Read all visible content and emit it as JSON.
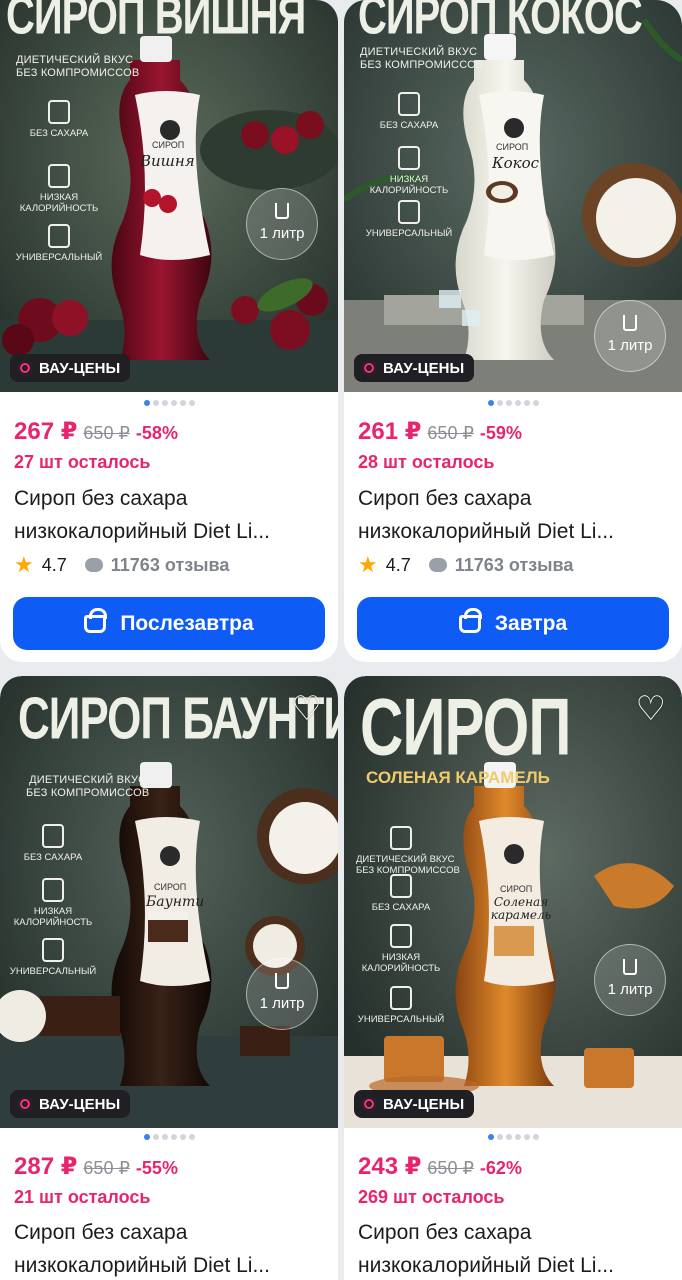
{
  "products": [
    {
      "banner_title": "СИРОП ВИШНЯ",
      "banner_sub": "ДИЕТИЧЕСКИЙ ВКУС\nБЕЗ КОМПРОМИССОВ",
      "features": [
        "БЕЗ САХАРА",
        "НИЗКАЯ\nКАЛОРИЙНОСТЬ",
        "УНИВЕРСАЛЬНЫЙ"
      ],
      "label_top": "СИРОП",
      "label_name": "Вишня",
      "volume": "1 литр",
      "badge": "ВАУ-ЦЕНЫ",
      "price": "267 ₽",
      "old_price": "650 ₽",
      "discount": "-58%",
      "stock": "27 шт осталось",
      "title_line1": "Сироп без сахара",
      "title_line2": "низкокалорийный Diet Li...",
      "rating": "4.7",
      "reviews": "11763 отзыва",
      "button": "Послезавтра",
      "colors": {
        "bg": "#3d4a3f",
        "liquid": "#7a0d22",
        "accent": "#c7192f"
      }
    },
    {
      "banner_title": "СИРОП КОКОС",
      "banner_sub": "ДИЕТИЧЕСКИЙ ВКУС\nБЕЗ КОМПРОМИССОВ",
      "features": [
        "БЕЗ САХАРА",
        "НИЗКАЯ\nКАЛОРИЙНОСТЬ",
        "УНИВЕРСАЛЬНЫЙ"
      ],
      "label_top": "СИРОП",
      "label_name": "Кокос",
      "volume": "1 литр",
      "badge": "ВАУ-ЦЕНЫ",
      "price": "261 ₽",
      "old_price": "650 ₽",
      "discount": "-59%",
      "stock": "28 шт осталось",
      "title_line1": "Сироп без сахара",
      "title_line2": "низкокалорийный Diet Li...",
      "rating": "4.7",
      "reviews": "11763 отзыва",
      "button": "Завтра",
      "colors": {
        "bg": "#3c4a45",
        "liquid": "#e9e8df",
        "accent": "#6b4a2d"
      }
    },
    {
      "banner_title": "СИРОП БАУНТИ",
      "banner_sub": "ДИЕТИЧЕСКИЙ ВКУС\nБЕЗ КОМПРОМИССОВ",
      "features": [
        "БЕЗ САХАРА",
        "НИЗКАЯ\nКАЛОРИЙНОСТЬ",
        "УНИВЕРСАЛЬНЫЙ"
      ],
      "label_top": "СИРОП",
      "label_name": "Баунти",
      "volume": "1 литр",
      "badge": "ВАУ-ЦЕНЫ",
      "price": "287 ₽",
      "old_price": "650 ₽",
      "discount": "-55%",
      "stock": "21 шт осталось",
      "title_line1": "Сироп без сахара",
      "title_line2": "низкокалорийный Diet Li...",
      "colors": {
        "bg": "#34423d",
        "liquid": "#2b1a14",
        "accent": "#4b2a1c"
      }
    },
    {
      "banner_title": "СИРОП",
      "banner_title2": "СОЛЕНАЯ КАРАМЕЛЬ",
      "banner_sub": "ДИЕТИЧЕСКИЙ ВКУС\nБЕЗ КОМПРОМИССОВ",
      "features": [
        "ДИЕТИЧЕСКИЙ ВКУС\nБЕЗ КОМПРОМИССОВ",
        "БЕЗ САХАРА",
        "НИЗКАЯ\nКАЛОРИЙНОСТЬ",
        "УНИВЕРСАЛЬНЫЙ"
      ],
      "label_top": "СИРОП",
      "label_name": "Соленая карамель",
      "volume": "1 литр",
      "badge": "ВАУ-ЦЕНЫ",
      "price": "243 ₽",
      "old_price": "650 ₽",
      "discount": "-62%",
      "stock": "269 шт осталось",
      "title_line1": "Сироп без сахара",
      "title_line2": "низкокалорийный Diet Li...",
      "colors": {
        "bg": "#3a4540",
        "liquid": "#c2701f",
        "accent": "#e39238"
      }
    }
  ]
}
